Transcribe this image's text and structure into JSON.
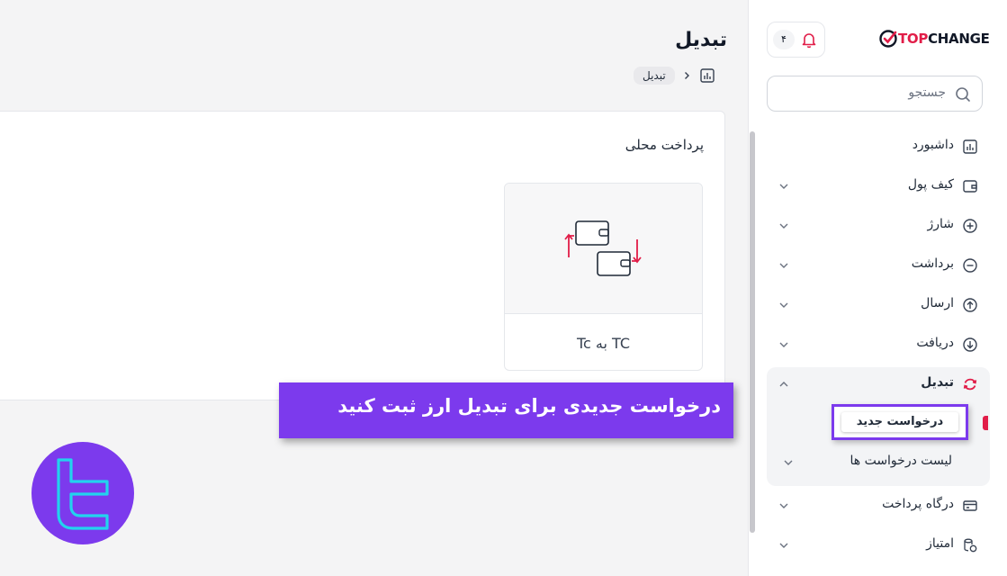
{
  "header": {
    "page_title": "تبدیل",
    "breadcrumb": "تبدیل"
  },
  "brand": {
    "top": "TOP",
    "change": "CHANGE",
    "accent": "#e11d48"
  },
  "notifications": {
    "count": "۴"
  },
  "search": {
    "placeholder": "جستجو"
  },
  "sidebar": {
    "items": [
      {
        "label": "داشبورد",
        "icon": "chart-icon"
      },
      {
        "label": "کیف پول",
        "icon": "wallet-icon"
      },
      {
        "label": "شارژ",
        "icon": "plus-circle-icon"
      },
      {
        "label": "برداشت",
        "icon": "minus-circle-icon"
      },
      {
        "label": "ارسال",
        "icon": "arrow-up-circle-icon"
      },
      {
        "label": "دریافت",
        "icon": "arrow-down-circle-icon"
      },
      {
        "label": "تبدیل",
        "icon": "exchange-icon"
      },
      {
        "label": "درگاه پرداخت",
        "icon": "card-icon"
      },
      {
        "label": "امتیاز",
        "icon": "coins-icon"
      }
    ],
    "submenu": [
      {
        "label": "درخواست جدید"
      },
      {
        "label": "لیست درخواست ها"
      }
    ]
  },
  "main": {
    "section_title": "پرداخت محلی",
    "option_label": "Tc به TC"
  },
  "banner": {
    "text": "درخواست جدیدی برای تبدیل ارز ثبت کنید",
    "color": "#7c3aed"
  }
}
